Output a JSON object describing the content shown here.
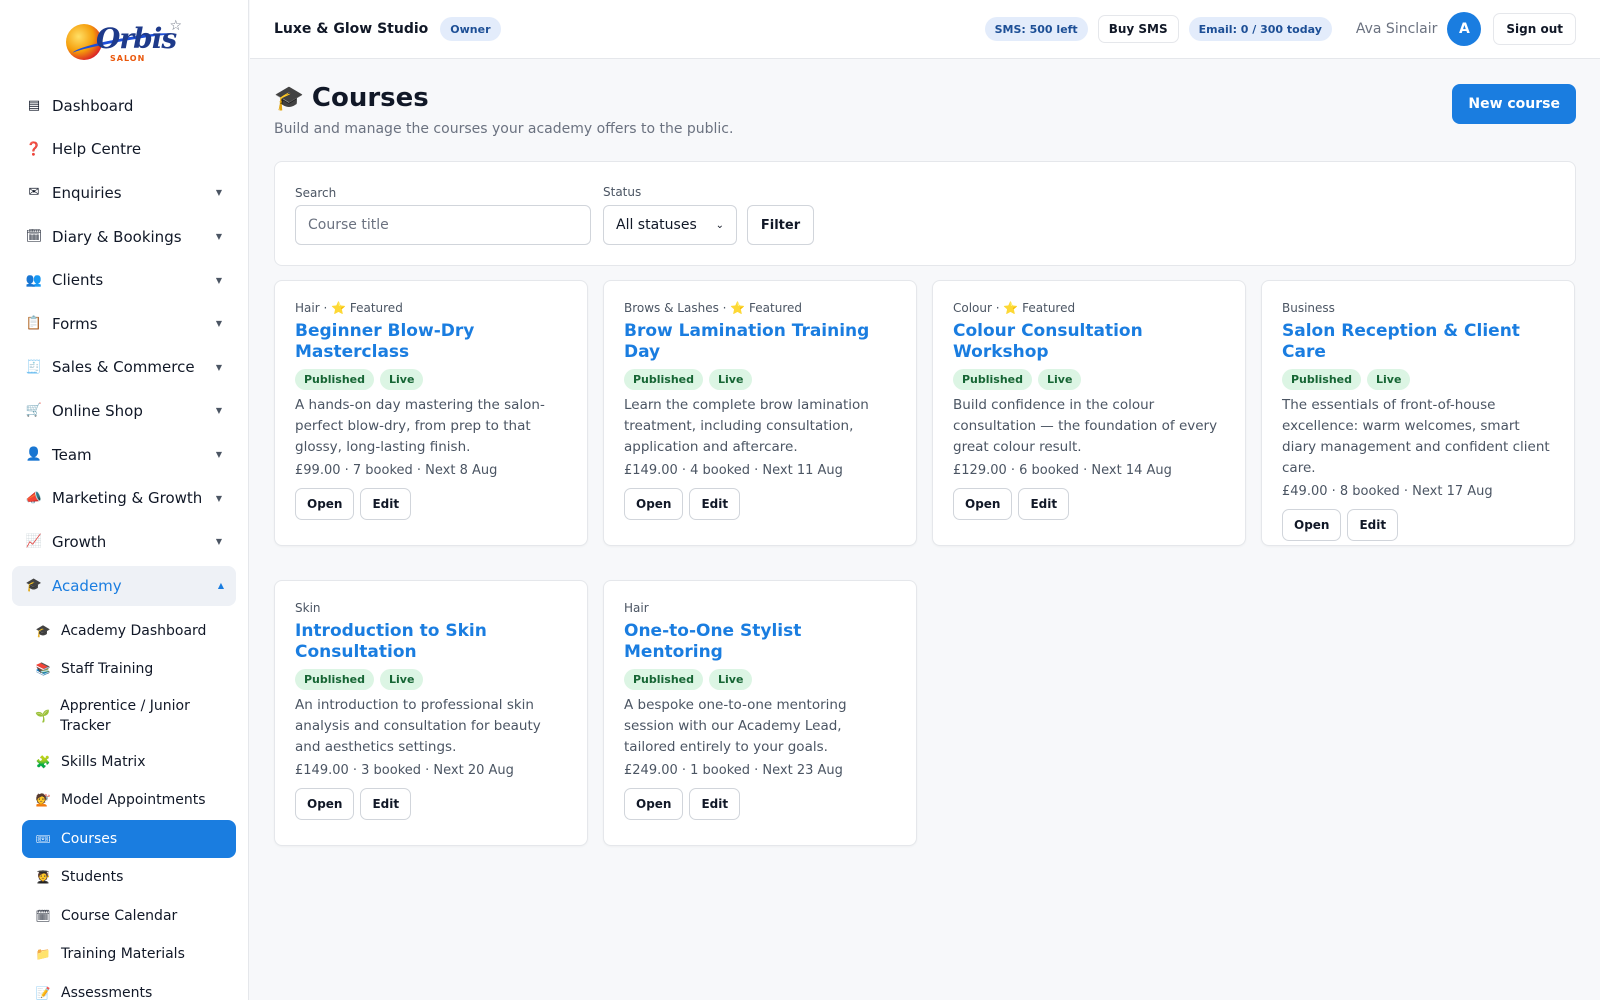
{
  "brand": {
    "logo_text": "Orbis",
    "logo_sub": "SALON"
  },
  "sidebar": {
    "items": [
      {
        "icon": "dashboard-icon",
        "glyph": "▤",
        "label": "Dashboard",
        "has_caret": false
      },
      {
        "icon": "help-icon",
        "glyph": "❓",
        "label": "Help Centre",
        "has_caret": false
      },
      {
        "icon": "envelope-icon",
        "glyph": "✉",
        "label": "Enquiries",
        "has_caret": true
      },
      {
        "icon": "calendar-icon",
        "glyph": "🗓",
        "label": "Diary & Bookings",
        "has_caret": true
      },
      {
        "icon": "clients-icon",
        "glyph": "👥",
        "label": "Clients",
        "has_caret": true
      },
      {
        "icon": "clipboard-icon",
        "glyph": "📋",
        "label": "Forms",
        "has_caret": true
      },
      {
        "icon": "receipt-icon",
        "glyph": "🧾",
        "label": "Sales & Commerce",
        "has_caret": true
      },
      {
        "icon": "cart-icon",
        "glyph": "🛒",
        "label": "Online Shop",
        "has_caret": true
      },
      {
        "icon": "person-icon",
        "glyph": "👤",
        "label": "Team",
        "has_caret": true
      },
      {
        "icon": "megaphone-icon",
        "glyph": "📣",
        "label": "Marketing & Growth",
        "has_caret": true
      },
      {
        "icon": "chart-up-icon",
        "glyph": "📈",
        "label": "Growth",
        "has_caret": true
      }
    ],
    "academy": {
      "icon": "graduation-cap-icon",
      "glyph": "🎓",
      "label": "Academy"
    },
    "caret_down": "▼",
    "caret_up": "▲",
    "sub_items": [
      {
        "icon": "graduation-cap-icon",
        "glyph": "🎓",
        "label": "Academy Dashboard"
      },
      {
        "icon": "books-icon",
        "glyph": "📚",
        "label": "Staff Training"
      },
      {
        "icon": "seedling-icon",
        "glyph": "🌱",
        "label": "Apprentice / Junior Tracker"
      },
      {
        "icon": "puzzle-icon",
        "glyph": "🧩",
        "label": "Skills Matrix"
      },
      {
        "icon": "haircut-icon",
        "glyph": "💇",
        "label": "Model Appointments"
      },
      {
        "icon": "ticket-icon",
        "glyph": "🎟",
        "label": "Courses",
        "active": true
      },
      {
        "icon": "student-icon",
        "glyph": "🧑‍🎓",
        "label": "Students"
      },
      {
        "icon": "calendar-icon",
        "glyph": "🗓",
        "label": "Course Calendar"
      },
      {
        "icon": "folder-icon",
        "glyph": "📁",
        "label": "Training Materials"
      },
      {
        "icon": "memo-icon",
        "glyph": "📝",
        "label": "Assessments"
      }
    ]
  },
  "topbar": {
    "studio": "Luxe & Glow Studio",
    "role": "Owner",
    "sms": "SMS: 500 left",
    "buy_sms": "Buy SMS",
    "email": "Email: 0 / 300 today",
    "user_name": "Ava Sinclair",
    "avatar_initial": "A",
    "sign_out": "Sign out"
  },
  "page": {
    "icon_glyph": "🎓",
    "title": "Courses",
    "subtitle": "Build and manage the courses your academy offers to the public.",
    "new_course": "New course"
  },
  "filters": {
    "search_label": "Search",
    "search_placeholder": "Course title",
    "search_value": "",
    "status_label": "Status",
    "status_value": "All statuses",
    "filter_button": "Filter"
  },
  "courses": [
    {
      "category": "Hair · ⭐ Featured",
      "title": "Beginner Blow-Dry Masterclass",
      "status": "Published",
      "state": "Live",
      "description": "A hands-on day mastering the salon-perfect blow-dry, from prep to that glossy, long-lasting finish.",
      "meta": "£99.00 · 7 booked · Next 8 Aug",
      "open": "Open",
      "edit": "Edit"
    },
    {
      "category": "Brows & Lashes · ⭐ Featured",
      "title": "Brow Lamination Training Day",
      "status": "Published",
      "state": "Live",
      "description": "Learn the complete brow lamination treatment, including consultation, application and aftercare.",
      "meta": "£149.00 · 4 booked · Next 11 Aug",
      "open": "Open",
      "edit": "Edit"
    },
    {
      "category": "Colour · ⭐ Featured",
      "title": "Colour Consultation Workshop",
      "status": "Published",
      "state": "Live",
      "description": "Build confidence in the colour consultation — the foundation of every great colour result.",
      "meta": "£129.00 · 6 booked · Next 14 Aug",
      "open": "Open",
      "edit": "Edit"
    },
    {
      "category": "Business",
      "title": "Salon Reception & Client Care",
      "status": "Published",
      "state": "Live",
      "description": "The essentials of front-of-house excellence: warm welcomes, smart diary management and confident client care.",
      "meta": "£49.00 · 8 booked · Next 17 Aug",
      "open": "Open",
      "edit": "Edit"
    },
    {
      "category": "Skin",
      "title": "Introduction to Skin Consultation",
      "status": "Published",
      "state": "Live",
      "description": "An introduction to professional skin analysis and consultation for beauty and aesthetics settings.",
      "meta": "£149.00 · 3 booked · Next 20 Aug",
      "open": "Open",
      "edit": "Edit"
    },
    {
      "category": "Hair",
      "title": "One-to-One Stylist Mentoring",
      "status": "Published",
      "state": "Live",
      "description": "A bespoke one-to-one mentoring session with our Academy Lead, tailored entirely to your goals.",
      "meta": "£249.00 · 1 booked · Next 23 Aug",
      "open": "Open",
      "edit": "Edit"
    }
  ],
  "colors": {
    "accent": "#1a7de0",
    "badge_bg": "#dcf5e4",
    "badge_text": "#166534",
    "info_pill_bg": "#e3ecfb"
  }
}
